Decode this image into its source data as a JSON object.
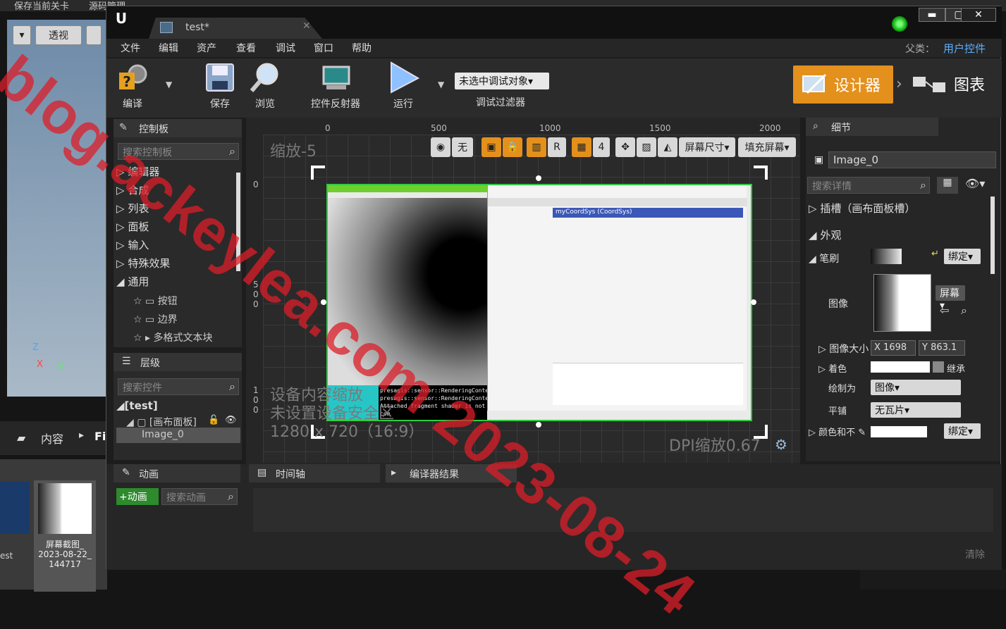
{
  "background": {
    "top_items": [
      "保存当前关卡",
      "源码管理"
    ],
    "viewport_perspective": "透视",
    "content_label": "内容",
    "content_path": "Fi",
    "asset_name": "屏幕截图_",
    "asset_date": "2023-08-22_",
    "asset_time": "144717",
    "left_asset": "est"
  },
  "window": {
    "tab_title": "test*",
    "parent_label": "父类：",
    "parent_value": "用户控件",
    "buttons": {
      "minimize": "▬",
      "maximize": "▢",
      "close": "✕"
    }
  },
  "menu": [
    "文件",
    "编辑",
    "资产",
    "查看",
    "调试",
    "窗口",
    "帮助"
  ],
  "toolbar": {
    "compile": "编译",
    "save": "保存",
    "browse": "浏览",
    "widget_reflector": "控件反射器",
    "run": "运行",
    "debug_object": "未选中调试对象▾",
    "debug_filter": "调试过滤器",
    "designer": "设计器",
    "graph": "图表"
  },
  "palette": {
    "title": "控制板",
    "search_placeholder": "搜索控制板",
    "categories": [
      "编辑器",
      "合成",
      "列表",
      "面板",
      "输入",
      "特殊效果",
      "通用"
    ],
    "common_items": [
      "按钮",
      "边界",
      "多格式文本块"
    ]
  },
  "hierarchy": {
    "title": "层级",
    "search_placeholder": "搜索控件",
    "root": "[test]",
    "canvas": "[画布面板]",
    "image": "Image_0"
  },
  "designer": {
    "ruler_top": [
      "0",
      "500",
      "1000",
      "1500",
      "2000"
    ],
    "ruler_left_0": "0",
    "ruler_left_500": [
      "5",
      "0",
      "0"
    ],
    "ruler_left_1000": [
      "1",
      "0",
      "0"
    ],
    "zoom": "缩放-5",
    "tools": {
      "none": "无",
      "grid_snap": "4",
      "r": "R",
      "screen_size": "屏幕尺寸▾",
      "fill_screen": "填充屏幕▾"
    },
    "info_line1": "设备内容缩放",
    "info_line2": "未设置设备安全区",
    "info_line3": "1280 x 720（16:9）",
    "dpi": "DPI缩放0.67",
    "console_lines": [
      "presagis::sensor::RenderingContextO",
      "presagis::sensor::RenderingContextO",
      "Attached fragment shader is not com"
    ],
    "inner_title": "myCoordSys (CoordSys)"
  },
  "details": {
    "title": "细节",
    "name": "Image_0",
    "search_placeholder": "搜索详情",
    "slot": "插槽（画布面板槽）",
    "appearance": "外观",
    "brush": "笔刷",
    "bind": "绑定▾",
    "image": "图像",
    "screen": "屏幕▾",
    "image_size": "图像大小",
    "size_x_label": "X",
    "size_x": "1698",
    "size_y_label": "Y",
    "size_y": "863.1",
    "tint": "着色",
    "inherit": "继承",
    "draw_as": "绘制为",
    "draw_as_value": "图像▾",
    "tiling": "平铺",
    "tiling_value": "无瓦片▾",
    "color_opacity": "颜色和不",
    "bind2": "绑定▾"
  },
  "bottom": {
    "animation_title": "动画",
    "add_animation": "+动画",
    "search_animation": "搜索动画",
    "timeline": "时间轴",
    "compiler_results": "编译器结果",
    "clear": "清除"
  },
  "watermark": "blog.ackeylea.com 2023-08-24"
}
